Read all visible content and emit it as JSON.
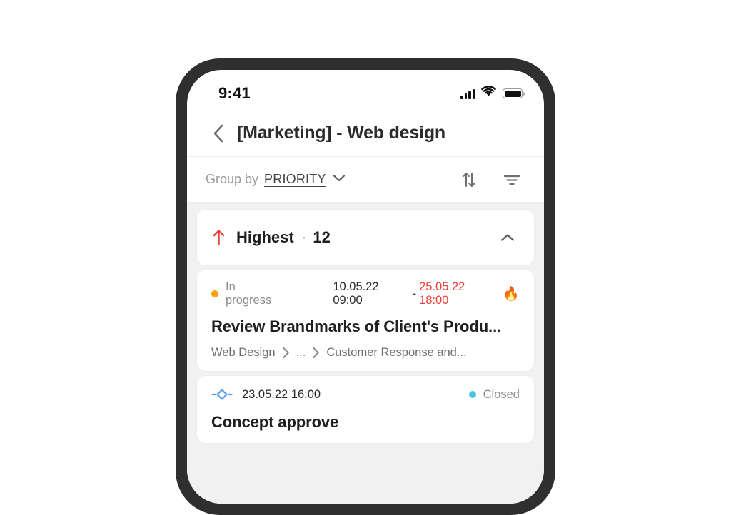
{
  "status_bar": {
    "time": "9:41",
    "signal_icon": "cellular-signal-icon",
    "wifi_icon": "wifi-icon",
    "battery_icon": "battery-icon"
  },
  "header": {
    "back_icon": "back-chevron-icon",
    "title": "[Marketing] - Web design"
  },
  "toolbar": {
    "group_by_label": "Group by",
    "group_by_value": "PRIORITY",
    "chevron_icon": "chevron-down-icon",
    "sort_icon": "sort-icon",
    "filter_icon": "filter-icon"
  },
  "group": {
    "priority_icon": "arrow-up-icon",
    "priority_color": "#ef3e36",
    "name": "Highest",
    "separator": "·",
    "count": "12",
    "collapse_icon": "chevron-up-icon"
  },
  "tasks": [
    {
      "status_label": "In progress",
      "status_color": "#ffa012",
      "date_start": "10.05.22 09:00",
      "date_separator": "-",
      "date_end": "25.05.22 18:00",
      "date_end_color": "#ef3e36",
      "flame_icon": "🔥",
      "title": "Review Brandmarks of Client's Produ...",
      "breadcrumb": {
        "first": "Web Design",
        "middle": "...",
        "last": "Customer Response and..."
      }
    },
    {
      "milestone_icon": "milestone-diamond-icon",
      "milestone_color": "#5b9bf3",
      "date": "23.05.22 16:00",
      "status_label": "Closed",
      "status_color": "#4cc3e0",
      "title": "Concept approve"
    }
  ],
  "colors": {
    "bezel": "#2f2f2f",
    "screen_bg": "#ffffff",
    "list_bg": "#f1f1f1",
    "card_bg": "#ffffff",
    "accent_red": "#ef3e36"
  }
}
